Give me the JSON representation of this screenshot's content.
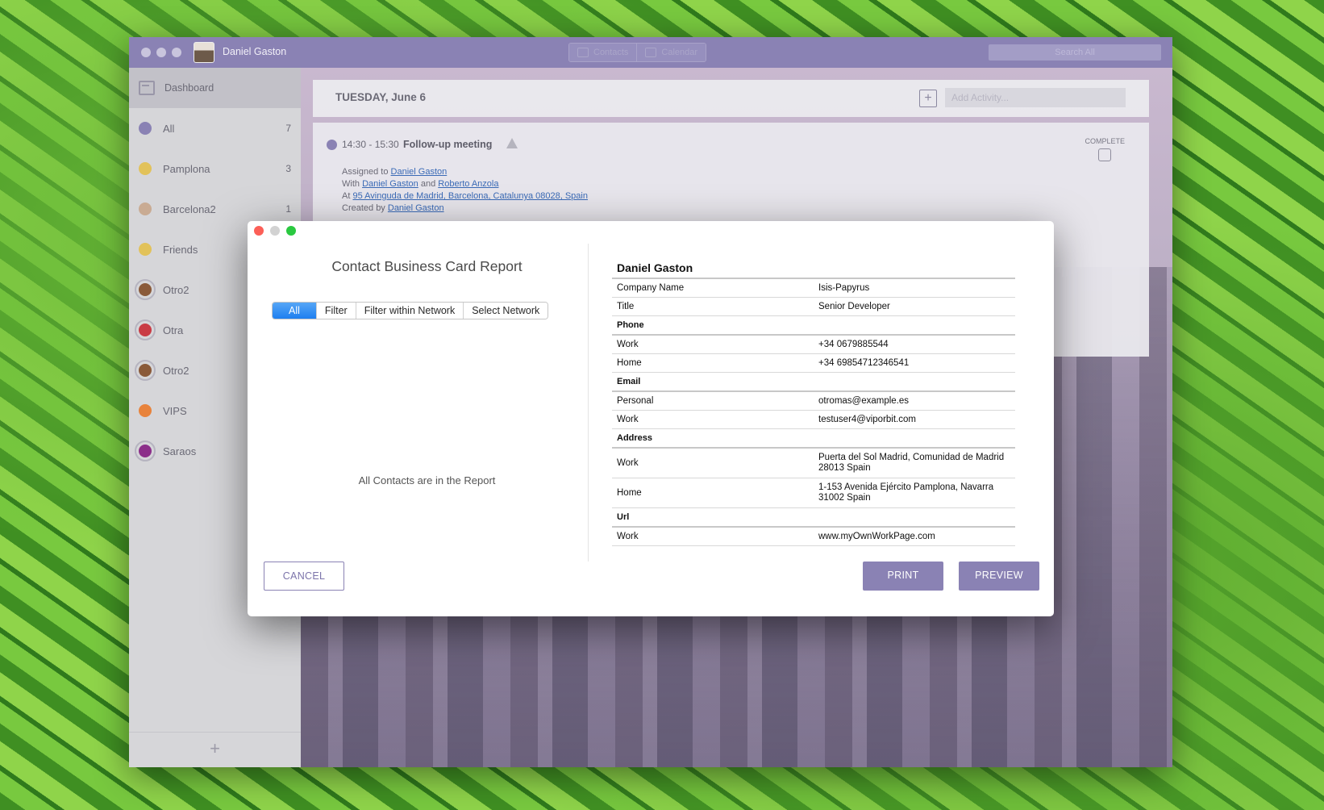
{
  "app": {
    "user_name": "Daniel Gaston",
    "tabs": [
      {
        "label": "Contacts"
      },
      {
        "label": "Calendar"
      }
    ],
    "search_placeholder": "Search All"
  },
  "sidebar": {
    "dashboard_label": "Dashboard",
    "groups": [
      {
        "label": "All",
        "count": "7",
        "color": "#8a82b4"
      },
      {
        "label": "Pamplona",
        "count": "3",
        "color": "#e2c25a"
      },
      {
        "label": "Barcelona2",
        "count": "1",
        "color": "#c9ab93"
      },
      {
        "label": "Friends",
        "count": "",
        "color": "#e2c25a"
      },
      {
        "label": "Otro2",
        "count": "",
        "color": "#8a5a3a"
      },
      {
        "label": "Otra",
        "count": "",
        "color": "#c93b45"
      },
      {
        "label": "Otro2",
        "count": "",
        "color": "#8a5a3a"
      },
      {
        "label": "VIPS",
        "count": "",
        "color": "#e8833c"
      },
      {
        "label": "Saraos",
        "count": "",
        "color": "#8c2f8a"
      }
    ],
    "add_icon": "plus-icon"
  },
  "calendar": {
    "day_title": "TUESDAY, June 6",
    "add_activity_placeholder": "Add Activity...",
    "activity": {
      "time": "14:30 - 15:30",
      "title": "Follow-up meeting",
      "complete_label": "COMPLETE",
      "assigned_prefix": "Assigned to",
      "assigned_to": "Daniel Gaston",
      "with_prefix": "With",
      "with_1": "Daniel Gaston",
      "with_and": "and",
      "with_2": "Roberto Anzola",
      "at_prefix": "At",
      "location": "95 Avinguda de Madrid, Barcelona, Catalunya 08028, Spain",
      "created_prefix": "Created by",
      "created_by": "Daniel Gaston"
    }
  },
  "dialog": {
    "title": "Contact Business Card Report",
    "segments": [
      "All",
      "Filter",
      "Filter within Network",
      "Select Network"
    ],
    "selected_segment": "All",
    "message": "All Contacts are in the Report",
    "card": {
      "name": "Daniel Gaston",
      "rows": [
        {
          "type": "field",
          "key": "Company Name",
          "value": "Isis-Papyrus"
        },
        {
          "type": "field",
          "key": "Title",
          "value": "Senior Developer"
        },
        {
          "type": "section",
          "key": "Phone",
          "value": ""
        },
        {
          "type": "field",
          "key": "Work",
          "value": "+34 0679885544"
        },
        {
          "type": "field",
          "key": "Home",
          "value": "+34 69854712346541"
        },
        {
          "type": "section",
          "key": "Email",
          "value": ""
        },
        {
          "type": "field",
          "key": "Personal",
          "value": "otromas@example.es"
        },
        {
          "type": "field",
          "key": "Work",
          "value": "testuser4@viporbit.com"
        },
        {
          "type": "section",
          "key": "Address",
          "value": ""
        },
        {
          "type": "field",
          "key": "Work",
          "value": "Puerta del Sol Madrid, Comunidad de Madrid 28013 Spain"
        },
        {
          "type": "field",
          "key": "Home",
          "value": "1-153 Avenida Ejército Pamplona, Navarra 31002 Spain"
        },
        {
          "type": "section",
          "key": "Url",
          "value": ""
        },
        {
          "type": "field",
          "key": "Work",
          "value": "www.myOwnWorkPage.com"
        }
      ]
    },
    "buttons": {
      "cancel": "CANCEL",
      "print": "PRINT",
      "preview": "PREVIEW"
    }
  }
}
